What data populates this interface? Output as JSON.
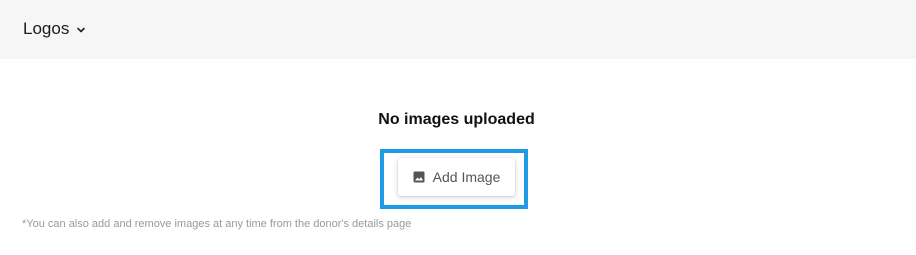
{
  "header": {
    "section_title": "Logos",
    "toggle_icon": "chevron-down-icon"
  },
  "empty_state": {
    "title": "No images uploaded",
    "add_button_label": "Add Image",
    "add_button_icon": "image-icon",
    "highlight_color": "#1f9be6"
  },
  "footnote": "*You can also add and remove images at any time from the donor's details page"
}
